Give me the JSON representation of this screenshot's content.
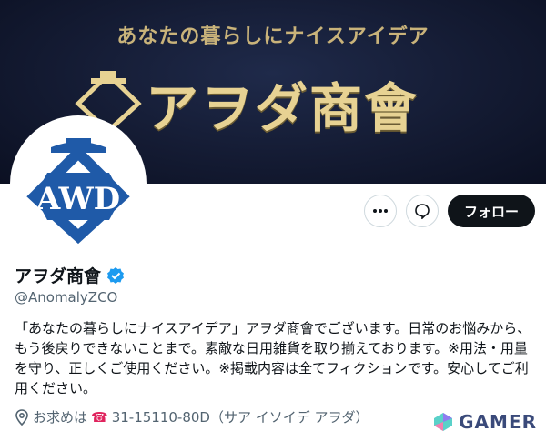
{
  "banner": {
    "tagline": "あなたの暮らしにナイスアイデア",
    "brand": "アヲダ商會",
    "colors": {
      "bg": "#141b33",
      "text": "#e7d293"
    }
  },
  "avatar": {
    "monogram": "AWD",
    "icon": "anomaly-emblem-icon",
    "color": "#1f5aa8"
  },
  "actions": {
    "more_icon": "more-icon",
    "message_icon": "message-icon",
    "follow_label": "フォロー"
  },
  "profile": {
    "display_name": "アヲダ商會",
    "verified_icon": "verified-badge-icon",
    "handle": "@AnomalyZCO",
    "bio": "「あなたの暮らしにナイスアイデア」アヲダ商會でございます。日常のお悩みから、もう後戻りできないことまで。素敵な日用雑貨を取り揃えております。※用法・用量を守り、正しくご使用ください。※掲載内容は全てフィクションです。安心してご利用ください。",
    "location_icon": "location-pin-icon",
    "location_prefix": "お求めは",
    "phone_icon": "telephone-icon",
    "location_rest": "31-15110-80D（サア イソイデ アヲダ）"
  },
  "watermark": {
    "text": "GAMER",
    "icon": "gamer-logo-icon"
  }
}
